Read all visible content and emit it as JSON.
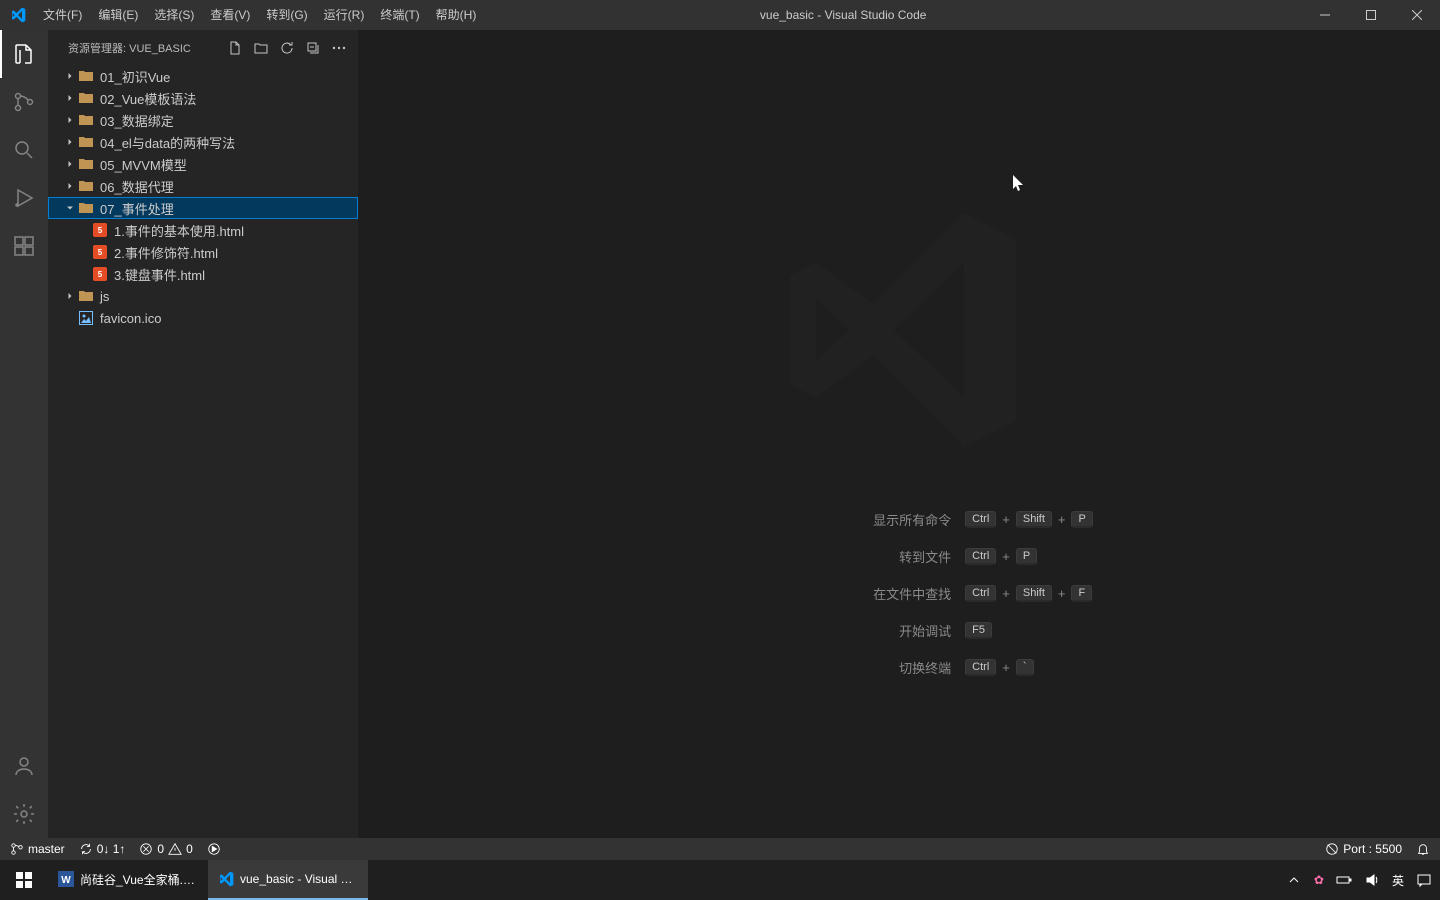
{
  "titlebar": {
    "menus": [
      "文件(F)",
      "编辑(E)",
      "选择(S)",
      "查看(V)",
      "转到(G)",
      "运行(R)",
      "终端(T)",
      "帮助(H)"
    ],
    "title": "vue_basic - Visual Studio Code"
  },
  "sidebar": {
    "header": "资源管理器: VUE_BASIC",
    "folders": [
      {
        "name": "01_初识Vue",
        "expanded": false
      },
      {
        "name": "02_Vue模板语法",
        "expanded": false
      },
      {
        "name": "03_数据绑定",
        "expanded": false
      },
      {
        "name": "04_el与data的两种写法",
        "expanded": false
      },
      {
        "name": "05_MVVM模型",
        "expanded": false
      },
      {
        "name": "06_数据代理",
        "expanded": false
      },
      {
        "name": "07_事件处理",
        "expanded": true,
        "selected": true,
        "children": [
          {
            "name": "1.事件的基本使用.html",
            "type": "html"
          },
          {
            "name": "2.事件修饰符.html",
            "type": "html"
          },
          {
            "name": "3.键盘事件.html",
            "type": "html"
          }
        ]
      },
      {
        "name": "js",
        "expanded": false
      }
    ],
    "files": [
      {
        "name": "favicon.ico",
        "type": "ico"
      }
    ]
  },
  "welcome": {
    "shortcuts": [
      {
        "label": "显示所有命令",
        "keys": [
          "Ctrl",
          "+",
          "Shift",
          "+",
          "P"
        ]
      },
      {
        "label": "转到文件",
        "keys": [
          "Ctrl",
          "+",
          "P"
        ]
      },
      {
        "label": "在文件中查找",
        "keys": [
          "Ctrl",
          "+",
          "Shift",
          "+",
          "F"
        ]
      },
      {
        "label": "开始调试",
        "keys": [
          "F5"
        ]
      },
      {
        "label": "切换终端",
        "keys": [
          "Ctrl",
          "+",
          "`"
        ]
      }
    ]
  },
  "statusbar": {
    "branch": "master",
    "sync": "0↓ 1↑",
    "errors": "0",
    "warnings": "0",
    "port": "Port : 5500"
  },
  "taskbar": {
    "tasks": [
      {
        "app": "word",
        "label": "尚硅谷_Vue全家桶.d...",
        "active": false
      },
      {
        "app": "vscode",
        "label": "vue_basic - Visual S...",
        "active": true
      }
    ],
    "ime": "英"
  }
}
